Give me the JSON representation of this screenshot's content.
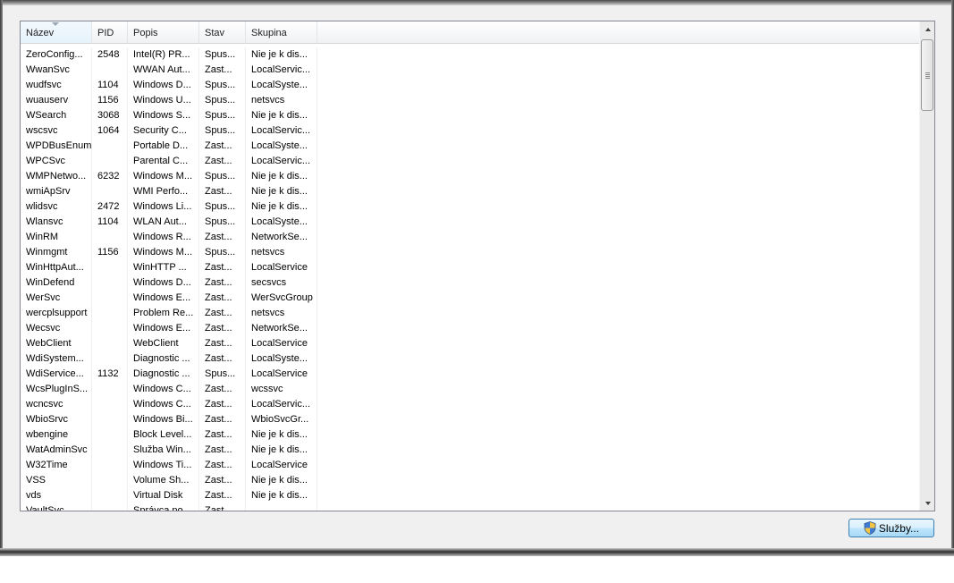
{
  "columns": [
    {
      "label": "Název"
    },
    {
      "label": "PID"
    },
    {
      "label": "Popis"
    },
    {
      "label": "Stav"
    },
    {
      "label": "Skupina"
    }
  ],
  "rows": [
    [
      "ZeroConfig...",
      "2548",
      "Intel(R) PR...",
      "Spus...",
      "Nie je k dis..."
    ],
    [
      "WwanSvc",
      "",
      "WWAN Aut...",
      "Zast...",
      "LocalServic..."
    ],
    [
      "wudfsvc",
      "1104",
      "Windows D...",
      "Spus...",
      "LocalSyste..."
    ],
    [
      "wuauserv",
      "1156",
      "Windows U...",
      "Spus...",
      "netsvcs"
    ],
    [
      "WSearch",
      "3068",
      "Windows S...",
      "Spus...",
      "Nie je k dis..."
    ],
    [
      "wscsvc",
      "1064",
      "Security C...",
      "Spus...",
      "LocalServic..."
    ],
    [
      "WPDBusEnum",
      "",
      "Portable D...",
      "Zast...",
      "LocalSyste..."
    ],
    [
      "WPCSvc",
      "",
      "Parental C...",
      "Zast...",
      "LocalServic..."
    ],
    [
      "WMPNetwo...",
      "6232",
      "Windows M...",
      "Spus...",
      "Nie je k dis..."
    ],
    [
      "wmiApSrv",
      "",
      "WMI Perfo...",
      "Zast...",
      "Nie je k dis..."
    ],
    [
      "wlidsvc",
      "2472",
      "Windows Li...",
      "Spus...",
      "Nie je k dis..."
    ],
    [
      "Wlansvc",
      "1104",
      "WLAN Aut...",
      "Spus...",
      "LocalSyste..."
    ],
    [
      "WinRM",
      "",
      "Windows R...",
      "Zast...",
      "NetworkSe..."
    ],
    [
      "Winmgmt",
      "1156",
      "Windows M...",
      "Spus...",
      "netsvcs"
    ],
    [
      "WinHttpAut...",
      "",
      "WinHTTP ...",
      "Zast...",
      "LocalService"
    ],
    [
      "WinDefend",
      "",
      "Windows D...",
      "Zast...",
      "secsvcs"
    ],
    [
      "WerSvc",
      "",
      "Windows E...",
      "Zast...",
      "WerSvcGroup"
    ],
    [
      "wercplsupport",
      "",
      "Problem Re...",
      "Zast...",
      "netsvcs"
    ],
    [
      "Wecsvc",
      "",
      "Windows E...",
      "Zast...",
      "NetworkSe..."
    ],
    [
      "WebClient",
      "",
      "WebClient",
      "Zast...",
      "LocalService"
    ],
    [
      "WdiSystem...",
      "",
      "Diagnostic ...",
      "Zast...",
      "LocalSyste..."
    ],
    [
      "WdiService...",
      "1132",
      "Diagnostic ...",
      "Spus...",
      "LocalService"
    ],
    [
      "WcsPlugInS...",
      "",
      "Windows C...",
      "Zast...",
      "wcssvc"
    ],
    [
      "wcncsvc",
      "",
      "Windows C...",
      "Zast...",
      "LocalServic..."
    ],
    [
      "WbioSrvc",
      "",
      "Windows Bi...",
      "Zast...",
      "WbioSvcGr..."
    ],
    [
      "wbengine",
      "",
      "Block Level...",
      "Zast...",
      "Nie je k dis..."
    ],
    [
      "WatAdminSvc",
      "",
      "Služba Win...",
      "Zast...",
      "Nie je k dis..."
    ],
    [
      "W32Time",
      "",
      "Windows Ti...",
      "Zast...",
      "LocalService"
    ],
    [
      "VSS",
      "",
      "Volume Sh...",
      "Zast...",
      "Nie je k dis..."
    ],
    [
      "vds",
      "",
      "Virtual Disk",
      "Zast...",
      "Nie je k dis..."
    ],
    [
      "VaultSvc",
      "",
      "Správca po...",
      "Zast...",
      ""
    ]
  ],
  "services_button": {
    "label": "Služby...",
    "icon": "uac-shield-icon"
  }
}
